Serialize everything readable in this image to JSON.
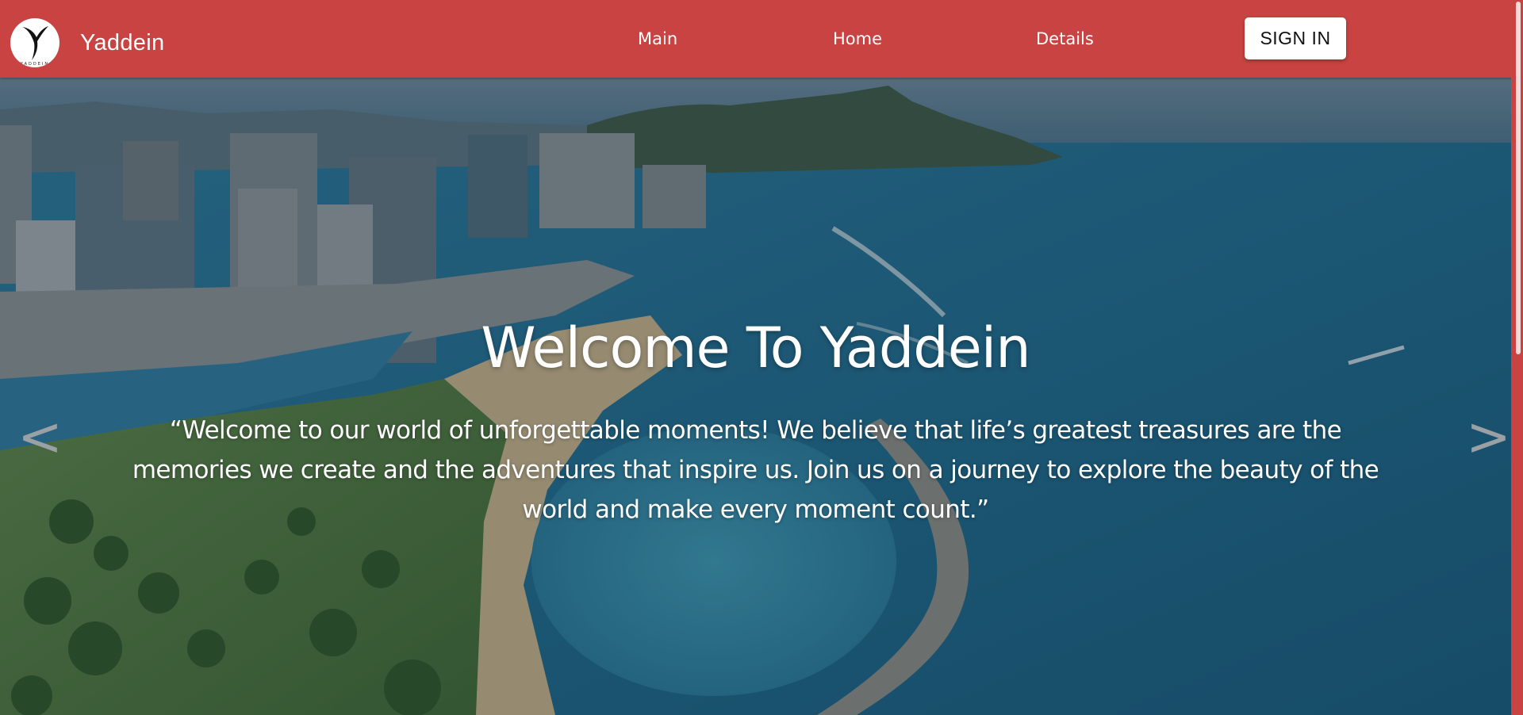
{
  "navbar": {
    "brand_name": "Yaddein",
    "logo_wordmark": "YADDEIN",
    "links": [
      {
        "label": "Main"
      },
      {
        "label": "Home"
      },
      {
        "label": "Details"
      }
    ],
    "signin_label": "SIGN IN",
    "background_color": "#c84341"
  },
  "hero": {
    "title": "Welcome To Yaddein",
    "quote": "“Welcome to our world of unforgettable moments! We believe that life’s greatest treasures are the memories we create and the adventures that inspire us. Join us on a journey to explore the beauty of the world and make every moment count.”",
    "prev_arrow": "<",
    "next_arrow": ">",
    "background_image": "aerial-coastline-city-photo"
  }
}
